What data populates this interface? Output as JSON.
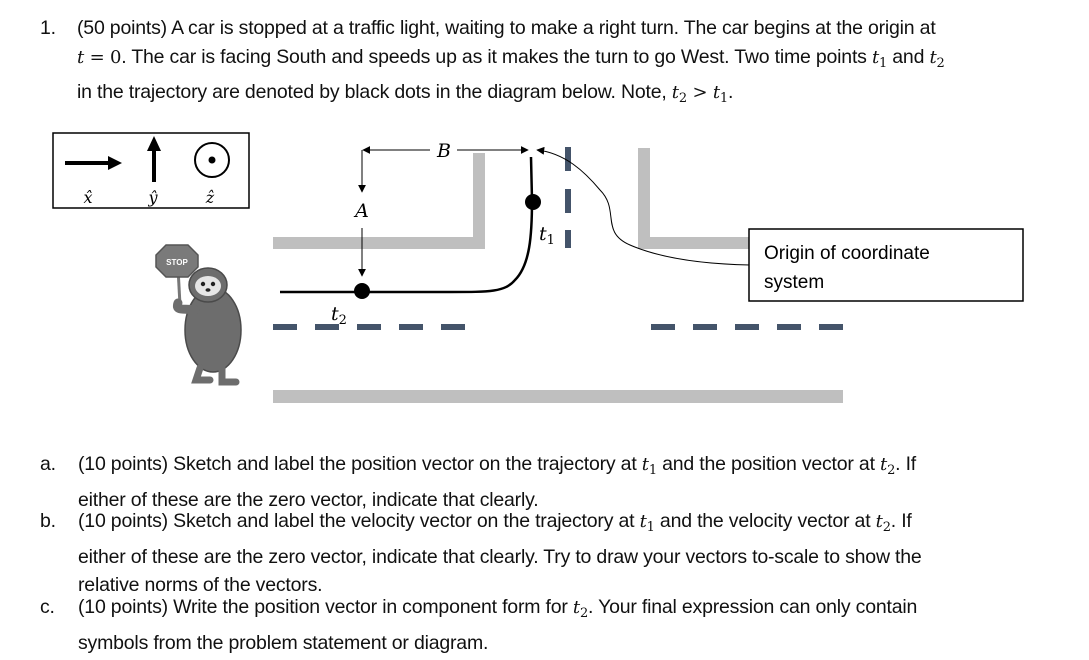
{
  "question": {
    "number": "1.",
    "points": "(50 points)",
    "line1": "A car is stopped at a traffic light, waiting to make a right turn. The car begins at the origin at",
    "line2_t": "t",
    "line2_eq": " = 0",
    "line2_rest": ". The car is facing South and speeds up as it makes the turn to go West. Two time points ",
    "line2_and": " and ",
    "line3_start": "in the trajectory are denoted by black dots in the diagram below.  Note, ",
    "line3_gt": " > ",
    "line3_end": "."
  },
  "symbols": {
    "t": "t",
    "sub1": "1",
    "sub2": "2"
  },
  "diagram": {
    "legend": {
      "x_label": "x̂",
      "y_label": "ŷ",
      "z_label": "ẑ",
      "x_icon": "arrow-right",
      "y_icon": "arrow-up",
      "z_icon": "circle-dot-out-of-page"
    },
    "label_A": "A",
    "label_B": "B",
    "label_t1": "t",
    "label_t2": "t",
    "stop_sign_text": "STOP",
    "origin_label_line1": "Origin of coordinate",
    "origin_label_line2": "system",
    "colors": {
      "curb": "#bfbfbf",
      "lane_dash": "#44546a",
      "trajectory": "#000000"
    }
  },
  "parts": [
    {
      "label": "a.",
      "points": "(10 points)",
      "text1": "Sketch and label the position vector on the trajectory at ",
      "text2": " and the position vector at ",
      "text3": ". If",
      "text4": "either of these are the zero vector, indicate that clearly."
    },
    {
      "label": "b.",
      "points": "(10 points)",
      "text1": "Sketch and label the velocity vector on the trajectory at ",
      "text2": " and the velocity vector at ",
      "text3": ".  If",
      "text4": "either of these are the zero vector, indicate that clearly. Try to draw your vectors to-scale to show the",
      "text5": "relative norms of the vectors."
    },
    {
      "label": "c.",
      "points": "(10 points)",
      "text1": "Write the position vector in component form for ",
      "text2": ". Your final expression can only contain",
      "text3": "symbols from the problem statement or diagram."
    }
  ]
}
